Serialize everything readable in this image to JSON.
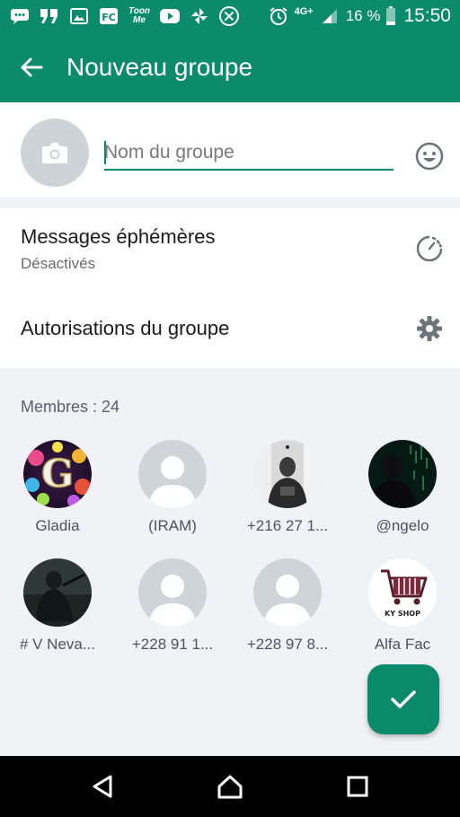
{
  "status_bar": {
    "toon_me_label": "Toon Me",
    "network": "4G+",
    "battery": "16 %",
    "time": "15:50"
  },
  "app_bar": {
    "title": "Nouveau groupe"
  },
  "group": {
    "name_placeholder": "Nom du groupe"
  },
  "settings": {
    "ephemeral_title": "Messages éphémères",
    "ephemeral_status": "Désactivés",
    "permissions_title": "Autorisations du groupe"
  },
  "members": {
    "header": "Membres  : 24",
    "list": [
      {
        "name": "Gladia"
      },
      {
        "name": "(IRAM)"
      },
      {
        "name": "+216 27 1..."
      },
      {
        "name": "@ngelo"
      },
      {
        "name": "# V Neva..."
      },
      {
        "name": "+228 91 1..."
      },
      {
        "name": "+228 97 8..."
      },
      {
        "name": "Alfa Fac"
      }
    ],
    "shop_logo_text": "KY SHOP"
  },
  "colors": {
    "primary": "#0b8a6c",
    "surface_gray": "#f0f2f5",
    "avatar_gray": "#cfd4d9"
  }
}
